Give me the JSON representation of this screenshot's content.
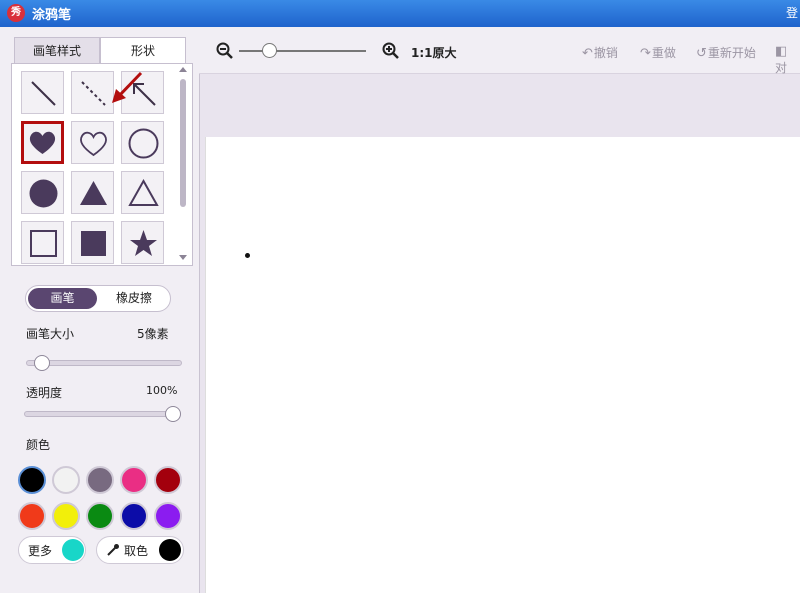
{
  "window": {
    "title": "涂鸦笔",
    "icon": "秀",
    "right_text": "登"
  },
  "left_panel": {
    "tabs": [
      {
        "label": "画笔样式"
      },
      {
        "label": "形状"
      }
    ],
    "active_tab": "形状",
    "shapes": [
      {
        "name": "line-icon"
      },
      {
        "name": "dashed-line-icon"
      },
      {
        "name": "arrow-line-icon"
      },
      {
        "name": "heart-filled-icon"
      },
      {
        "name": "heart-outline-icon"
      },
      {
        "name": "circle-outline-icon"
      },
      {
        "name": "circle-filled-icon"
      },
      {
        "name": "triangle-filled-icon"
      },
      {
        "name": "triangle-outline-icon"
      },
      {
        "name": "square-outline-icon"
      },
      {
        "name": "square-filled-icon"
      },
      {
        "name": "star-filled-icon"
      }
    ],
    "selected_shape": "heart-filled-icon",
    "mode_toggle": {
      "brush": "画笔",
      "eraser": "橡皮擦",
      "active": "画笔"
    },
    "brush_size": {
      "label": "画笔大小",
      "value": "5像素",
      "fraction": 0.05
    },
    "opacity": {
      "label": "透明度",
      "value": "100%",
      "fraction": 1.0
    },
    "color_label": "颜色",
    "colors": [
      "#000000",
      "#f2f2f2",
      "#786a80",
      "#ea2e84",
      "#a3000d",
      "#f03a1a",
      "#f2ef0a",
      "#0a8a12",
      "#0c0ca8",
      "#8b1cf0"
    ],
    "selected_color": "#000000",
    "more": {
      "label": "更多",
      "color": "#18d6c8"
    },
    "picker": {
      "label": "取色",
      "color": "#000000"
    }
  },
  "toolbar": {
    "zoom_label": "1:1原大",
    "zoom_fraction": 0.2,
    "undo": "撤销",
    "redo": "重做",
    "restart": "重新开始",
    "compare": "对"
  },
  "colors": {
    "accent": "#5a4670",
    "highlight": "#b30e0e",
    "titlebar": "#2a74dc"
  }
}
